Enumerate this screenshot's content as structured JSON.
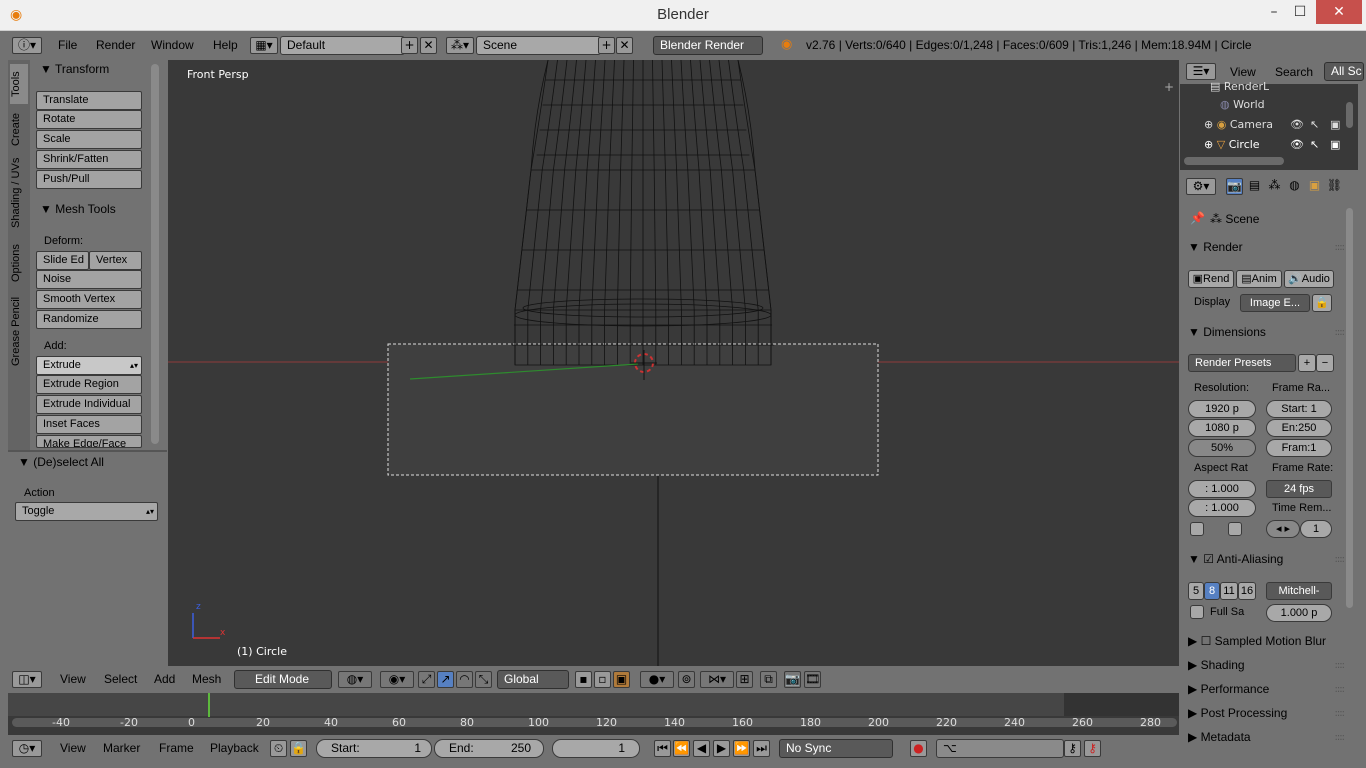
{
  "window": {
    "title": "Blender",
    "min": "–",
    "max": "☐",
    "close": "✕"
  },
  "menu": {
    "file": "File",
    "render": "Render",
    "window": "Window",
    "help": "Help"
  },
  "layout": {
    "value": "Default"
  },
  "scene": {
    "value": "Scene"
  },
  "engine": {
    "value": "Blender Render"
  },
  "stats": "v2.76 | Verts:0/640 | Edges:0/1,248 | Faces:0/609 | Tris:1,246 | Mem:18.94M | Circle",
  "toolshelf": {
    "tabs": [
      "Tools",
      "Create",
      "Shading / UVs",
      "Options",
      "Grease Pencil"
    ],
    "transform_title": "Transform",
    "transform": [
      "Translate",
      "Rotate",
      "Scale",
      "Shrink/Fatten",
      "Push/Pull"
    ],
    "mesh_tools_title": "Mesh Tools",
    "deform_label": "Deform:",
    "slide_edge": "Slide Ed",
    "vertex": "Vertex",
    "deform": [
      "Noise",
      "Smooth Vertex",
      "Randomize"
    ],
    "add_label": "Add:",
    "extrude": "Extrude",
    "add": [
      "Extrude Region",
      "Extrude Individual",
      "Inset Faces",
      "Make Edge/Face"
    ],
    "deselect_title": "(De)select All",
    "action_label": "Action",
    "action_value": "Toggle"
  },
  "viewport": {
    "view_name": "Front Persp",
    "object_label": "(1) Circle",
    "axis_z": "z",
    "axis_x": "x"
  },
  "view_header": {
    "view": "View",
    "select": "Select",
    "add": "Add",
    "mesh": "Mesh",
    "mode": "Edit Mode",
    "orientation": "Global"
  },
  "timeline": {
    "ticks": [
      "-40",
      "-20",
      "0",
      "20",
      "40",
      "60",
      "80",
      "100",
      "120",
      "140",
      "160",
      "180",
      "200",
      "220",
      "240",
      "260",
      "280"
    ]
  },
  "timeline_bar": {
    "view": "View",
    "marker": "Marker",
    "frame": "Frame",
    "playback": "Playback",
    "start_label": "Start:",
    "start": "1",
    "end_label": "End:",
    "end": "250",
    "current": "1",
    "sync": "No Sync"
  },
  "outliner": {
    "view": "View",
    "search": "Search",
    "all_scenes": "All Sc",
    "items": [
      "RenderL",
      "World",
      "Camera",
      "Circle"
    ]
  },
  "properties": {
    "context": "Scene",
    "render_title": "Render",
    "render_btn": "Rend",
    "anim_btn": "Anim",
    "audio_btn": "Audio",
    "display_label": "Display",
    "display_value": "Image E...",
    "dimensions_title": "Dimensions",
    "presets": "Render Presets",
    "resolution_label": "Resolution:",
    "res_x": "1920 p",
    "res_y": "1080 p",
    "res_pct": "50%",
    "frame_range_label": "Frame Ra...",
    "frame_start": "Start: 1",
    "frame_end": "En:250",
    "frame_step": "Fram:1",
    "aspect_label": "Aspect Rat",
    "aspect_x": ": 1.000",
    "aspect_y": ": 1.000",
    "frame_rate_label": "Frame Rate:",
    "frame_rate": "24 fps",
    "time_remap_label": "Time Rem...",
    "time_remap": "1",
    "aa_title": "Anti-Aliasing",
    "aa_samples": [
      "5",
      "8",
      "11",
      "16"
    ],
    "aa_filter": "Mitchell-",
    "full_sample": "Full Sa",
    "filter_size": "1.000 p",
    "panels": [
      "Sampled Motion Blur",
      "Shading",
      "Performance",
      "Post Processing",
      "Metadata"
    ]
  }
}
